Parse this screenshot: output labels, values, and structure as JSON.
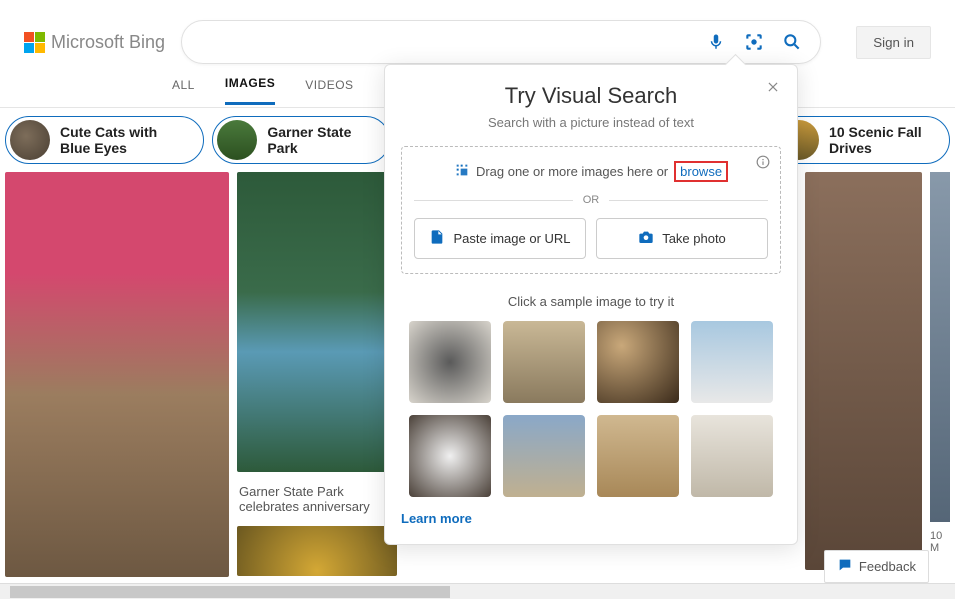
{
  "header": {
    "logo": "Microsoft Bing",
    "signin": "Sign in",
    "icons": {
      "mic": "mic-icon",
      "lens": "visual-search-icon",
      "search": "search-icon"
    }
  },
  "tabs": {
    "all": "ALL",
    "images": "IMAGES",
    "videos": "VIDEOS"
  },
  "pills": [
    {
      "label": "Cute Cats with Blue Eyes"
    },
    {
      "label": "Garner State Park"
    },
    {
      "label": "10 Scenic Fall Drives"
    }
  ],
  "results": {
    "park_caption": "Garner State Park celebrates anniversary",
    "right_caption": "10 M"
  },
  "popover": {
    "title": "Try Visual Search",
    "subtitle": "Search with a picture instead of text",
    "drag_text": "Drag one or more images here or",
    "browse": "browse",
    "or": "OR",
    "paste_btn": "Paste image or URL",
    "photo_btn": "Take photo",
    "sample_title": "Click a sample image to try it",
    "learn_more": "Learn more"
  },
  "feedback": {
    "label": "Feedback"
  }
}
